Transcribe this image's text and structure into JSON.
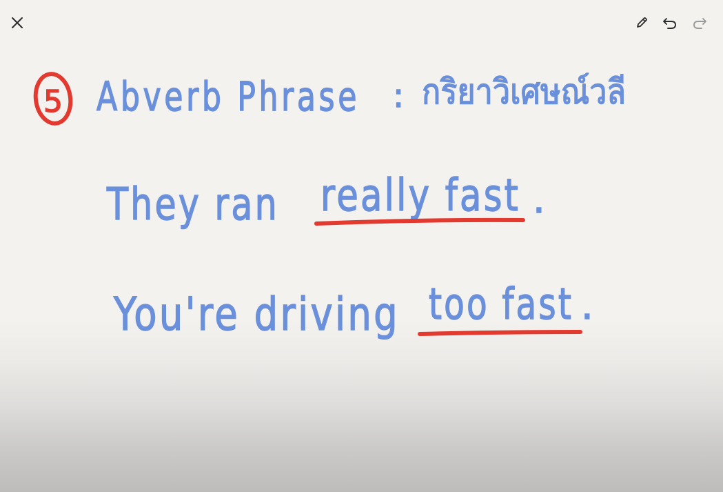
{
  "toolbar": {
    "close_icon": "close-icon",
    "pen_icon": "pencil-icon",
    "undo_icon": "undo-icon",
    "redo_icon": "redo-icon",
    "redo_enabled": false
  },
  "colors": {
    "ink_blue": "#6a8fdb",
    "ink_red": "#e23a2f",
    "icon_dark": "#2b2b2b",
    "icon_disabled": "#9a9a9a",
    "background": "#f4f2ef"
  },
  "notes": {
    "heading": {
      "number": "5",
      "title": "Abverb Phrase",
      "separator": ":",
      "thai": "กริยาวิเศษณ์วลี"
    },
    "line1": {
      "prefix": "They ran",
      "underlined": "really fast",
      "suffix": "."
    },
    "line2": {
      "prefix": "You're driving",
      "underlined": "too fast",
      "suffix": "."
    }
  }
}
